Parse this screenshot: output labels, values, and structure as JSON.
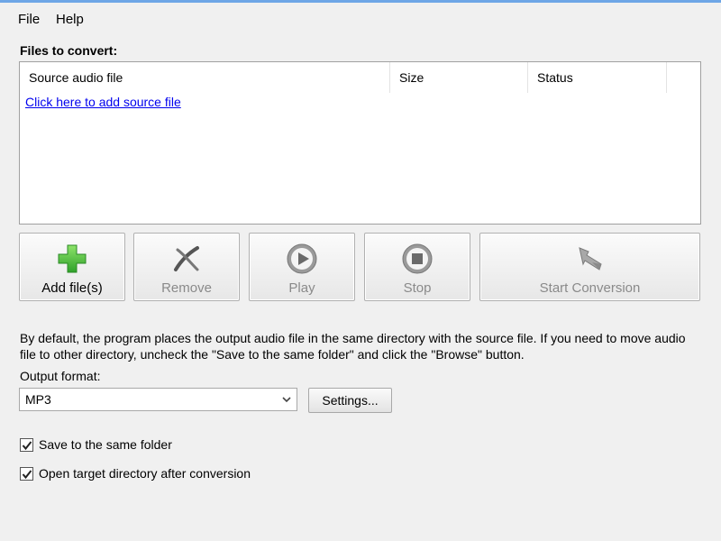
{
  "menu": {
    "file": "File",
    "help": "Help"
  },
  "files_group": {
    "title": "Files to convert:",
    "columns": [
      "Source audio file",
      "Size",
      "Status",
      ""
    ],
    "add_link": "Click here to add source file"
  },
  "toolbar": {
    "add": "Add file(s)",
    "remove": "Remove",
    "play": "Play",
    "stop": "Stop",
    "start": "Start Conversion"
  },
  "info_text": "By default, the program places the output audio file in the same directory with the source file. If you need to move audio file to other directory, uncheck the \"Save to the same folder\" and click the \"Browse\" button.",
  "output": {
    "label": "Output format:",
    "selected": "MP3",
    "settings_label": "Settings..."
  },
  "options": {
    "save_same_folder": {
      "label": "Save to the same folder",
      "checked": true
    },
    "open_target_dir": {
      "label": "Open target directory after conversion",
      "checked": true
    }
  },
  "icons": {
    "add": "plus-icon",
    "remove": "remove-x-icon",
    "play": "play-icon",
    "stop": "stop-icon",
    "start": "convert-arrow-icon"
  },
  "colors": {
    "accent_green": "#3cc43c",
    "link_blue": "#0000ee",
    "disabled_text": "#8a8a8a"
  }
}
